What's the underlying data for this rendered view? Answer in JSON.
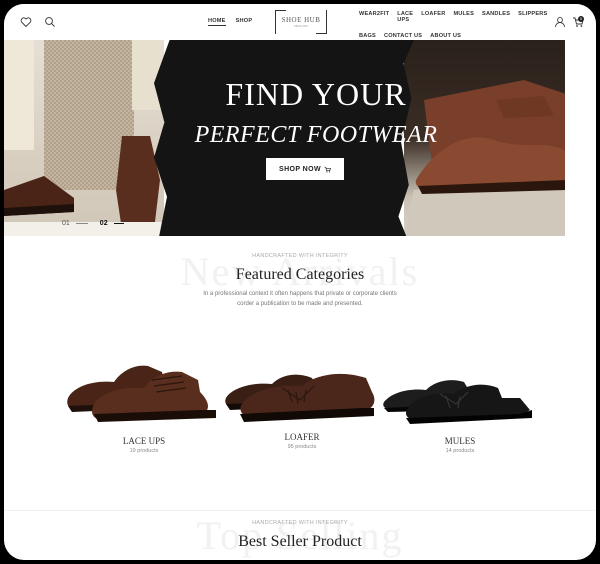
{
  "header": {
    "nav_left": [
      "HOME",
      "SHOP"
    ],
    "logo": "SHOE HUB",
    "logo_sub": "SINCE 2015",
    "nav_right_row1": [
      "WEAR2FIT",
      "LACE UPS",
      "LOAFER",
      "MULES",
      "SANDLES",
      "SLIPPERS"
    ],
    "nav_right_row2": [
      "BAGS",
      "CONTACT US",
      "ABOUT US"
    ],
    "cart_count": "0",
    "icons": [
      "heart-icon",
      "search-icon",
      "user-icon",
      "cart-icon"
    ]
  },
  "hero": {
    "title": "FIND YOUR",
    "subtitle": "PERFECT FOOTWEAR",
    "cta": "SHOP NOW",
    "pager": [
      "01",
      "02"
    ]
  },
  "featured": {
    "ghost": "New Arrivals",
    "eyebrow": "HANDCRAFTED WITH INTEGRITY",
    "title": "Featured Categories",
    "description": "In a professional context it often happens that private or corporate clients corder a publication to be made and presented.",
    "categories": [
      {
        "name": "LACE UPS",
        "count": "19 products"
      },
      {
        "name": "LOAFER",
        "count": "95 products"
      },
      {
        "name": "MULES",
        "count": "14 products"
      }
    ]
  },
  "bestseller": {
    "ghost": "Top Selling",
    "eyebrow": "HANDCRAFTED WITH INTEGRITY",
    "title": "Best Seller Product"
  },
  "colors": {
    "hero_dark": "#141414",
    "text": "#222222",
    "muted": "#888888",
    "brown": "#5a2e1e",
    "black_shoe": "#1a1a1a"
  }
}
